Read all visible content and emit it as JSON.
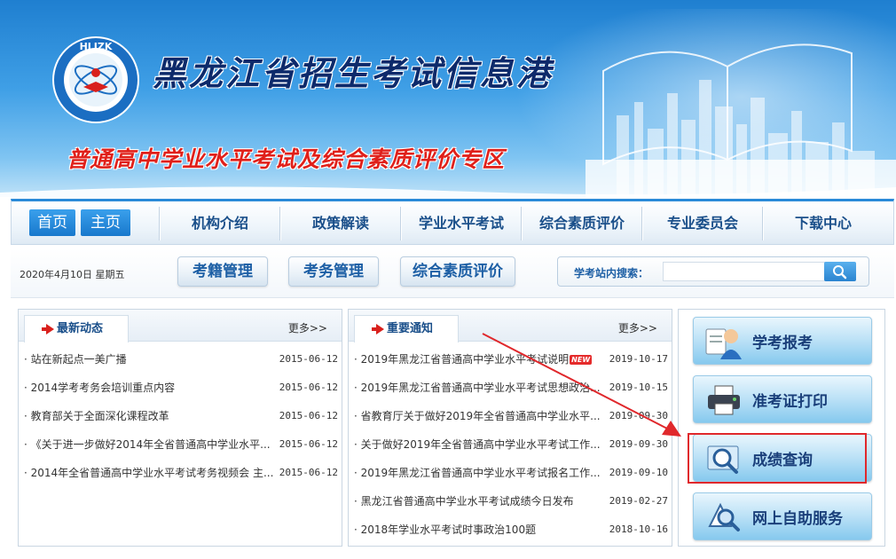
{
  "banner": {
    "logo_text": "HLJZK",
    "logo_ring_text": "黑龙江招生考试信息港",
    "title": "黑龙江省招生考试信息港",
    "subtitle": "普通高中学业水平考试及综合素质评价专区"
  },
  "nav": {
    "home_btn": "首页",
    "main_btn": "主页",
    "items": [
      "机构介绍",
      "政策解读",
      "学业水平考试",
      "综合素质评价",
      "专业委员会",
      "下载中心"
    ]
  },
  "subbar": {
    "date": "2020年4月10日 星期五",
    "pills": [
      "考籍管理",
      "考务管理",
      "综合素质评价"
    ],
    "search_label": "学考站内搜索：",
    "search_value": ""
  },
  "news": {
    "tab": "最新动态",
    "more": "更多>>",
    "items": [
      {
        "title": "· 站在新起点一美广播",
        "date": "2015-06-12"
      },
      {
        "title": "· 2014学考考务会培训重点内容",
        "date": "2015-06-12"
      },
      {
        "title": "· 教育部关于全面深化课程改革",
        "date": "2015-06-12"
      },
      {
        "title": "· 《关于进一步做好2014年全省普通高中学业水平...",
        "date": "2015-06-12"
      },
      {
        "title": "· 2014年全省普通高中学业水平考试考务视频会 主...",
        "date": "2015-06-12"
      }
    ]
  },
  "notices": {
    "tab": "重要通知",
    "more": "更多>>",
    "new_badge": "NEW",
    "items": [
      {
        "title": "· 2019年黑龙江省普通高中学业水平考试说明",
        "date": "2019-10-17"
      },
      {
        "title": "· 2019年黑龙江省普通高中学业水平考试思想政治...",
        "date": "2019-10-15"
      },
      {
        "title": "· 省教育厅关于做好2019年全省普通高中学业水平...",
        "date": "2019-09-30"
      },
      {
        "title": "· 关于做好2019年全省普通高中学业水平考试工作...",
        "date": "2019-09-30"
      },
      {
        "title": "· 2019年黑龙江省普通高中学业水平考试报名工作...",
        "date": "2019-09-10"
      },
      {
        "title": "· 黑龙江省普通高中学业水平考试成绩今日发布",
        "date": "2019-02-27"
      },
      {
        "title": "· 2018年学业水平考试时事政治100题",
        "date": "2018-10-16"
      }
    ]
  },
  "services": {
    "items": [
      "学考报考",
      "准考证打印",
      "成绩查询",
      "网上自助服务"
    ]
  },
  "colors": {
    "accent_blue": "#1878cc",
    "nav_text": "#1a4f8a",
    "highlight_red": "#e0282c"
  }
}
